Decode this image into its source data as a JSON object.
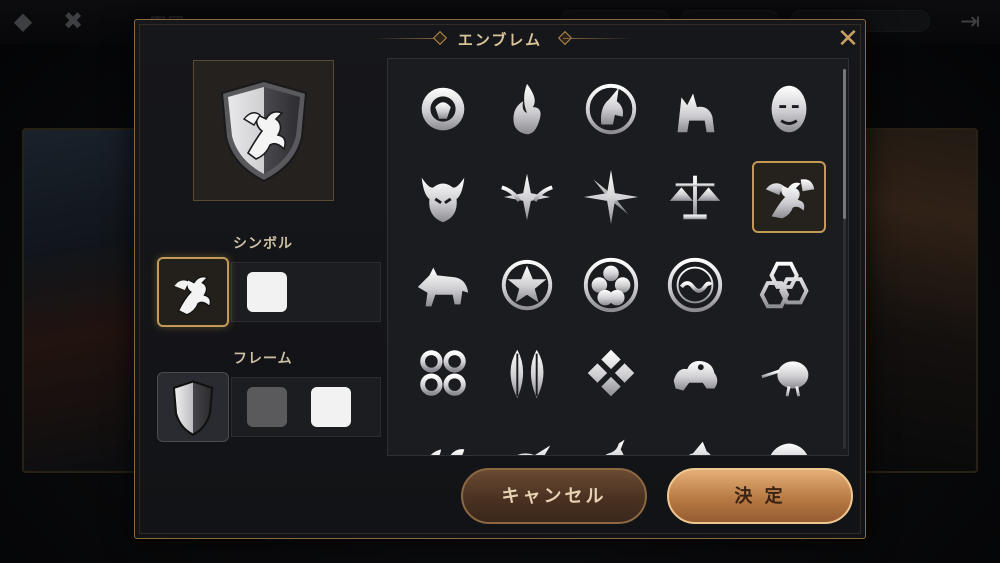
{
  "header": {
    "title": "軍団"
  },
  "dialog": {
    "title": "エンブレム",
    "close_icon": "close-x-icon",
    "sections": {
      "symbol_label": "シンボル",
      "frame_label": "フレーム"
    },
    "symbol_colors": [
      "#f2f2f2"
    ],
    "frame_colors": [
      "#5a5a5c",
      "#f2f2f2"
    ],
    "buttons": {
      "cancel": "キャンセル",
      "confirm": "決 定"
    },
    "selected_symbol": "dragon-emblem-icon"
  },
  "emblems": [
    [
      "lion-emblem-icon",
      "flame-emblem-icon",
      "unicorn-emblem-icon",
      "cat-emblem-icon",
      "bald-man-emblem-icon"
    ],
    [
      "demon-emblem-icon",
      "star-wings-emblem-icon",
      "compass-star-emblem-icon",
      "scales-emblem-icon",
      "dragon-emblem-icon"
    ],
    [
      "wolf-emblem-icon",
      "flower-crest-emblem-icon",
      "plum-crest-emblem-icon",
      "wave-crest-emblem-icon",
      "hexagon-knot-emblem-icon"
    ],
    [
      "rings-emblem-icon",
      "feathers-emblem-icon",
      "diamonds-emblem-icon",
      "frog-emblem-icon",
      "kiwi-bird-emblem-icon"
    ],
    [
      "leaf-emblem-icon",
      "bird-emblem-icon",
      "swan-emblem-icon",
      "critter-emblem-icon",
      "shell-emblem-icon"
    ]
  ]
}
